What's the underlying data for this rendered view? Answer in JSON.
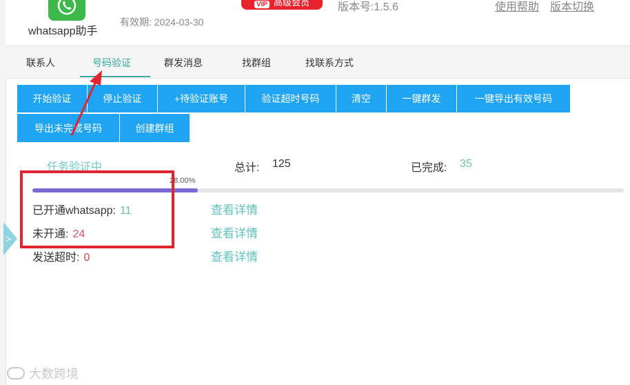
{
  "header": {
    "app_name": "whatsapp助手",
    "expiry": "有效期: 2024-03-30",
    "vip_mark": "VIP",
    "vip_label": "高级会员",
    "version": "版本号:1.5.6",
    "help_link": "使用帮助",
    "switch_link": "版本切换"
  },
  "tabs": [
    {
      "label": "联系人",
      "active": false
    },
    {
      "label": "号码验证",
      "active": true
    },
    {
      "label": "群发消息",
      "active": false
    },
    {
      "label": "找群组",
      "active": false
    },
    {
      "label": "找联系方式",
      "active": false
    }
  ],
  "toolbar": {
    "row1": [
      "开始验证",
      "停止验证",
      "+待验证账号",
      "验证超时号码",
      "清空",
      "一键群发",
      "一键导出有效号码"
    ],
    "row2": [
      "导出未完成号码",
      "创建群组"
    ]
  },
  "status": {
    "title": "任务验证中",
    "total_label": "总计:",
    "total_value": "125",
    "done_label": "已完成:",
    "done_value": "35",
    "progress_text": "28.00%",
    "progress_fraction": 0.28
  },
  "results": [
    {
      "label": "已开通whatsapp:",
      "value": "11",
      "color": "#6cc19a",
      "link": "查看详情"
    },
    {
      "label": "未开通:",
      "value": "24",
      "color": "#d14d7a",
      "link": "查看详情"
    },
    {
      "label": "发送超时:",
      "value": "0",
      "color": "#d1434b",
      "link": "查看详情"
    }
  ],
  "side_handle": ">",
  "watermark": "大数跨境",
  "colors": {
    "accent_teal": "#37a7a0",
    "button_blue": "#1ea4f0",
    "progress_purple": "#7b6ad6",
    "annotation_red": "#e1242f"
  }
}
